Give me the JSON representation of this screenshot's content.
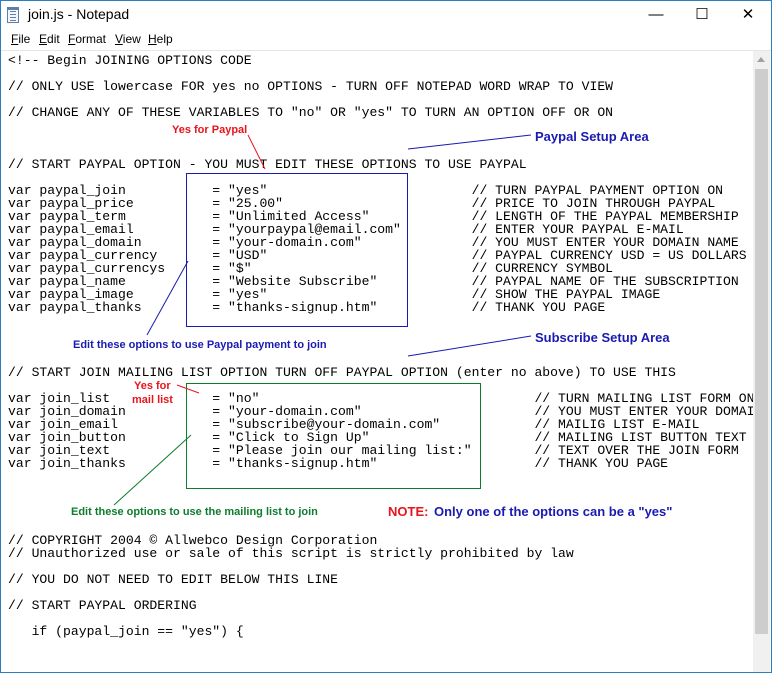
{
  "window": {
    "title": "join.js - Notepad",
    "controls": {
      "minimize": "—",
      "maximize": "☐",
      "close": "✕"
    },
    "icon": "notepad-icon"
  },
  "menu": [
    "File",
    "Edit",
    "Format",
    "View",
    "Help"
  ],
  "code_lines": [
    "<!-- Begin JOINING OPTIONS CODE",
    "// ONLY USE lowercase FOR yes no OPTIONS - TURN OFF NOTEPAD WORD WRAP TO VIEW",
    "// CHANGE ANY OF THESE VARIABLES TO \"no\" OR \"yes\" TO TURN AN OPTION OFF OR ON",
    "// START PAYPAL OPTION - YOU MUST EDIT THESE OPTIONS TO USE PAYPAL",
    "var paypal_join           = \"yes\"                          // TURN PAYPAL PAYMENT OPTION ON",
    "var paypal_price          = \"25.00\"                        // PRICE TO JOIN THROUGH PAYPAL",
    "var paypal_term           = \"Unlimited Access\"             // LENGTH OF THE PAYPAL MEMBERSHIP",
    "var paypal_email          = \"yourpaypal@email.com\"         // ENTER YOUR PAYPAL E-MAIL",
    "var paypal_domain         = \"your-domain.com\"              // YOU MUST ENTER YOUR DOMAIN NAME",
    "var paypal_currency       = \"USD\"                          // PAYPAL CURRENCY USD = US DOLLARS",
    "var paypal_currencys      = \"$\"                            // CURRENCY SYMBOL",
    "var paypal_name           = \"Website Subscribe\"            // PAYPAL NAME OF THE SUBSCRIPTION",
    "var paypal_image          = \"yes\"                          // SHOW THE PAYPAL IMAGE",
    "var paypal_thanks         = \"thanks-signup.htm\"            // THANK YOU PAGE",
    "// START JOIN MAILING LIST OPTION TURN OFF PAYPAL OPTION (enter no above) TO USE THIS",
    "var join_list             = \"no\"                                   // TURN MAILING LIST FORM ON",
    "var join_domain           = \"your-domain.com\"                      // YOU MUST ENTER YOUR DOMAIN",
    "var join_email            = \"subscribe@your-domain.com\"            // MAILIG LIST E-MAIL",
    "var join_button           = \"Click to Sign Up\"                     // MAILING LIST BUTTON TEXT",
    "var join_text             = \"Please join our mailing list:\"        // TEXT OVER THE JOIN FORM",
    "var join_thanks           = \"thanks-signup.htm\"                    // THANK YOU PAGE",
    "// COPYRIGHT 2004 © Allwebco Design Corporation",
    "// Unauthorized use or sale of this script is strictly prohibited by law",
    "// YOU DO NOT NEED TO EDIT BELOW THIS LINE",
    "// START PAYPAL ORDERING",
    "   if (paypal_join == \"yes\") {"
  ],
  "annotations": {
    "yes_for_paypal": "Yes for Paypal",
    "paypal_setup_area": "Paypal Setup Area",
    "edit_paypal": "Edit these options to use Paypal payment to join",
    "subscribe_setup_area": "Subscribe Setup Area",
    "yes_for_mail_line1": "Yes for",
    "yes_for_mail_line2": "mail list",
    "edit_mailing": "Edit these options to use the mailing list to join",
    "note_label": "NOTE:",
    "note_text": "Only one of the options can be a \"yes\""
  },
  "colors": {
    "red": "#e8141b",
    "blue": "#1a1ab2",
    "green": "#0c7d2c",
    "window_border": "#2b7ec0"
  }
}
